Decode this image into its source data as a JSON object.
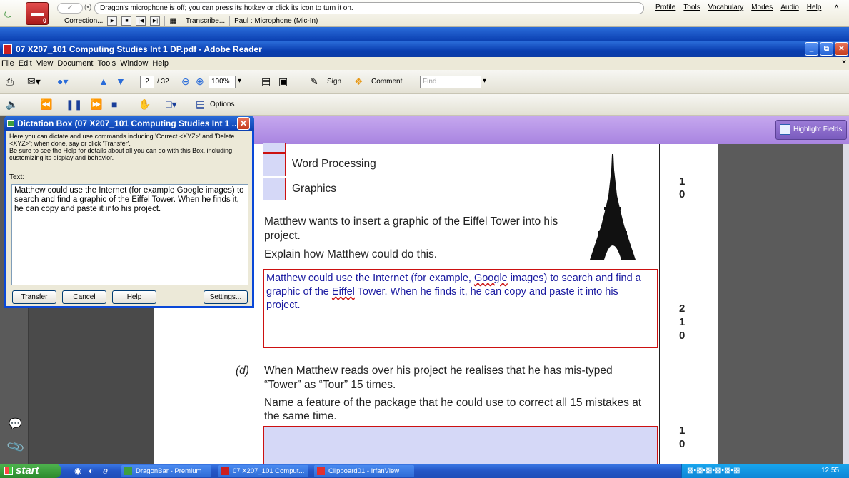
{
  "dragonbar": {
    "message": "Dragon's microphone is off; you can press its hotkey or click its icon to turn it on.",
    "menu": [
      "Profile",
      "Tools",
      "Vocabulary",
      "Modes",
      "Audio",
      "Help"
    ],
    "correction_label": "Correction...",
    "transcribe_label": "Transcribe...",
    "microphone_label": "Paul : Microphone (Mic-In)"
  },
  "reader": {
    "title": "07 X207_101 Computing Studies  Int 1 DP.pdf - Adobe Reader",
    "menu": [
      "File",
      "Edit",
      "View",
      "Document",
      "Tools",
      "Window",
      "Help"
    ],
    "page_current": "2",
    "page_total": "/ 32",
    "zoom": "100%",
    "sign_label": "Sign",
    "comment_label": "Comment",
    "find_placeholder": "Find",
    "options_label": "Options",
    "highlight_label": "Highlight Fields"
  },
  "dictation": {
    "title": "Dictation Box (07 X207_101 Computing Studies  Int 1 ...",
    "help": "Here you can dictate and use commands including 'Correct <XYZ>' and 'Delete <XYZ>'; when done, say or click 'Transfer'.\nBe sure to see the Help for details about all you can do with this Box, including customizing its display and behavior.",
    "text_label": "Text:",
    "text": "Matthew could use the Internet (for example Google images) to search and find a graphic of the Eiffel Tower. When he finds it, he can copy and paste it into his project.",
    "buttons": {
      "transfer": "Transfer",
      "cancel": "Cancel",
      "help": "Help",
      "settings": "Settings..."
    }
  },
  "page": {
    "options": [
      "Word Processing",
      "Graphics"
    ],
    "question_c": [
      "Matthew wants to insert a graphic of the Eiffel Tower into his",
      "project."
    ],
    "question_c_explain": "Explain how Matthew could do this.",
    "answer_parts": {
      "p1": "Matthew could use the Internet (for example, ",
      "w1": "Google",
      "p2": " images) to search and find a graphic of the ",
      "w2": "Eiffel",
      "p3": " Tower. When he finds it, he can copy and paste it into his project."
    },
    "question_d_label": "(d)",
    "question_d": [
      "When Matthew reads over his project he realises that he has mis-typed",
      "“Tower” as “Tour” 15 times."
    ],
    "question_d_name": [
      "Name a feature of the package that he could use to correct all 15 mistakes at",
      "the same time."
    ],
    "marks_a": [
      "1",
      "0"
    ],
    "marks_c": [
      "2",
      "1",
      "0"
    ],
    "marks_d": [
      "1",
      "0"
    ]
  },
  "taskbar": {
    "start": "start",
    "tasks": [
      "DragonBar - Premium",
      "07 X207_101 Comput...",
      "Clipboard01 - IrfanView"
    ],
    "clock": "12:55"
  },
  "colors": {
    "xp_blue": "#0a3eb0",
    "form_field": "#d5d8f7",
    "field_border": "#cc1111",
    "answer_text": "#1a1aa0",
    "forms_bar": "#b08ee6"
  }
}
